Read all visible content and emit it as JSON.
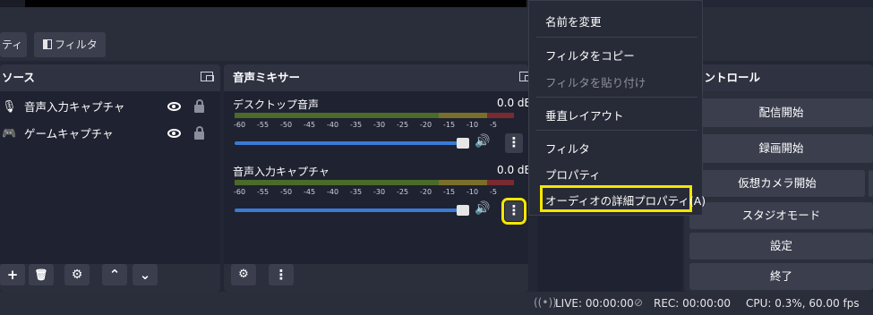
{
  "toolbar": {
    "left_tab_label": "ティ",
    "filter_label": "フィルタ",
    "filter_icon": "filter-icon"
  },
  "sources": {
    "title": "ソース",
    "items": [
      {
        "label": "音声入力キャプチャ",
        "icon": "microphone-icon"
      },
      {
        "label": "ゲームキャプチャ",
        "icon": "gamepad-icon"
      }
    ],
    "footer": {
      "add": "+",
      "up": "⌃",
      "down": "⌄"
    }
  },
  "mixer": {
    "title": "音声ミキサー",
    "channels": [
      {
        "name": "デスクトップ音声",
        "db": "0.0 dB"
      },
      {
        "name": "音声入力キャプチャ",
        "db": "0.0 dB"
      }
    ],
    "ticks": [
      "-60",
      "-55",
      "-50",
      "-45",
      "-40",
      "-35",
      "-30",
      "-25",
      "-20",
      "-15",
      "-10",
      "-5"
    ]
  },
  "controls": {
    "title": "コントロール",
    "buttons": [
      "配信開始",
      "録画開始",
      "仮想カメラ開始",
      "スタジオモード",
      "設定",
      "終了"
    ]
  },
  "context_menu": {
    "items": [
      {
        "label": "名前を変更",
        "enabled": true
      },
      {
        "label": "フィルタをコピー",
        "enabled": true
      },
      {
        "label": "フィルタを貼り付け",
        "enabled": false
      },
      {
        "label": "垂直レイアウト",
        "enabled": true
      },
      {
        "label": "フィルタ",
        "enabled": true
      },
      {
        "label": "プロパティ",
        "enabled": true
      },
      {
        "label": "オーディオの詳細プロパティ(A)",
        "enabled": true
      }
    ]
  },
  "status_bar": {
    "live": "LIVE: 00:00:00",
    "rec": "REC: 00:00:00",
    "cpu": "CPU: 0.3%, 60.00 fps"
  },
  "colors": {
    "background": "#232634",
    "highlight": "#f5e600",
    "fader": "#3a7bd5"
  }
}
